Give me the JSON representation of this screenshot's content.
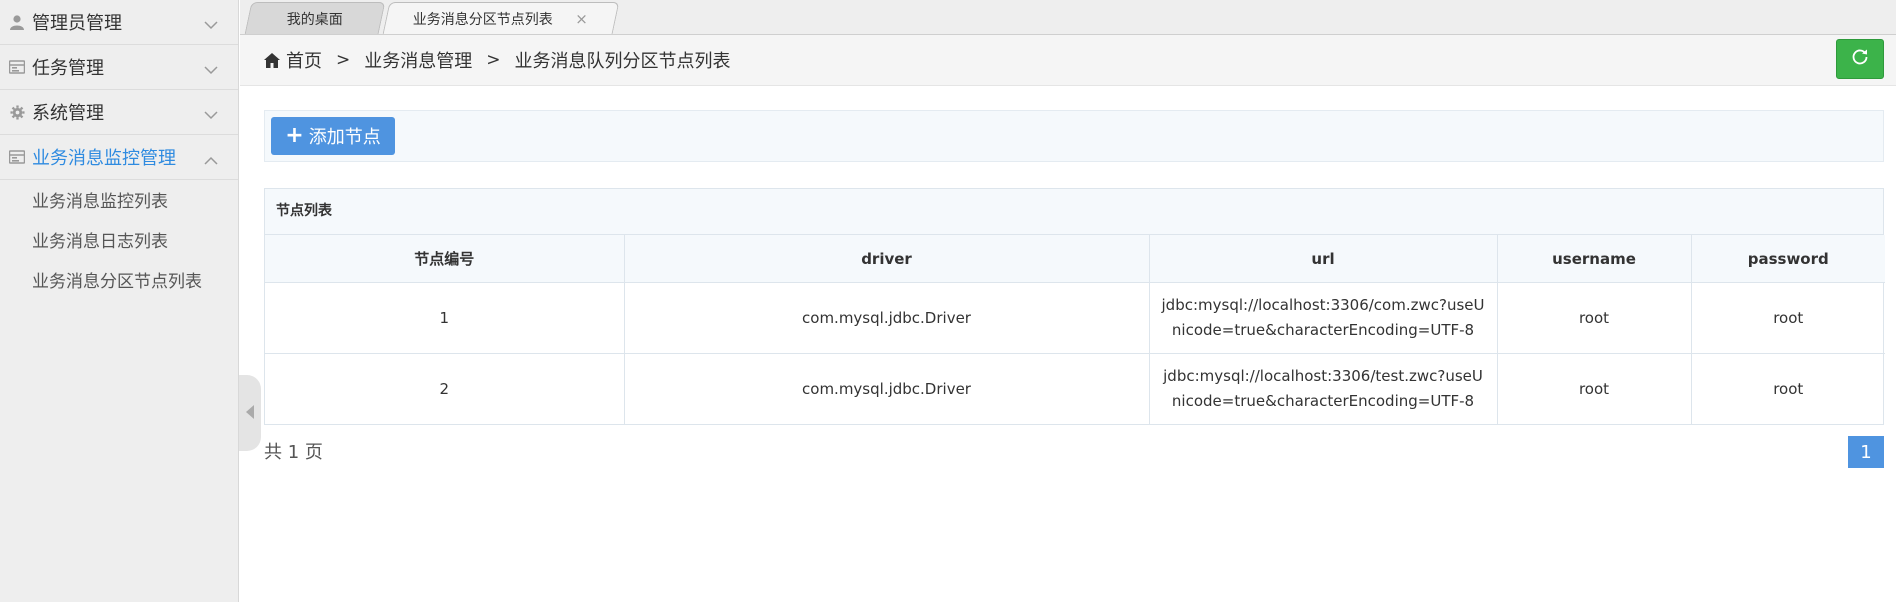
{
  "sidebar": {
    "groups": [
      {
        "label": "管理员管理",
        "icon": "user-icon"
      },
      {
        "label": "任务管理",
        "icon": "task-icon"
      },
      {
        "label": "系统管理",
        "icon": "gear-icon"
      },
      {
        "label": "业务消息监控管理",
        "icon": "monitor-icon"
      }
    ],
    "subitems": [
      {
        "label": "业务消息监控列表"
      },
      {
        "label": "业务消息日志列表"
      },
      {
        "label": "业务消息分区节点列表"
      }
    ]
  },
  "tabs": [
    {
      "label": "我的桌面"
    },
    {
      "label": "业务消息分区节点列表",
      "close": "×"
    }
  ],
  "breadcrumb": {
    "items": [
      "首页",
      "业务消息管理",
      "业务消息队列分区节点列表"
    ],
    "separator": ">"
  },
  "toolbar": {
    "add_label": "添加节点",
    "add_icon": "+"
  },
  "panel": {
    "title": "节点列表",
    "columns": [
      "节点编号",
      "driver",
      "url",
      "username",
      "password"
    ],
    "rows": [
      [
        "1",
        "com.mysql.jdbc.Driver",
        "jdbc:mysql://localhost:3306/com.zwc?useUnicode=true&characterEncoding=UTF-8",
        "root",
        "root"
      ],
      [
        "2",
        "com.mysql.jdbc.Driver",
        "jdbc:mysql://localhost:3306/test.zwc?useUnicode=true&characterEncoding=UTF-8",
        "root",
        "root"
      ]
    ]
  },
  "pagination": {
    "summary": "共 1 页",
    "current": "1"
  },
  "colors": {
    "accent": "#4f94e0",
    "active_menu": "#2f8be0",
    "refresh": "#3cb34a"
  }
}
